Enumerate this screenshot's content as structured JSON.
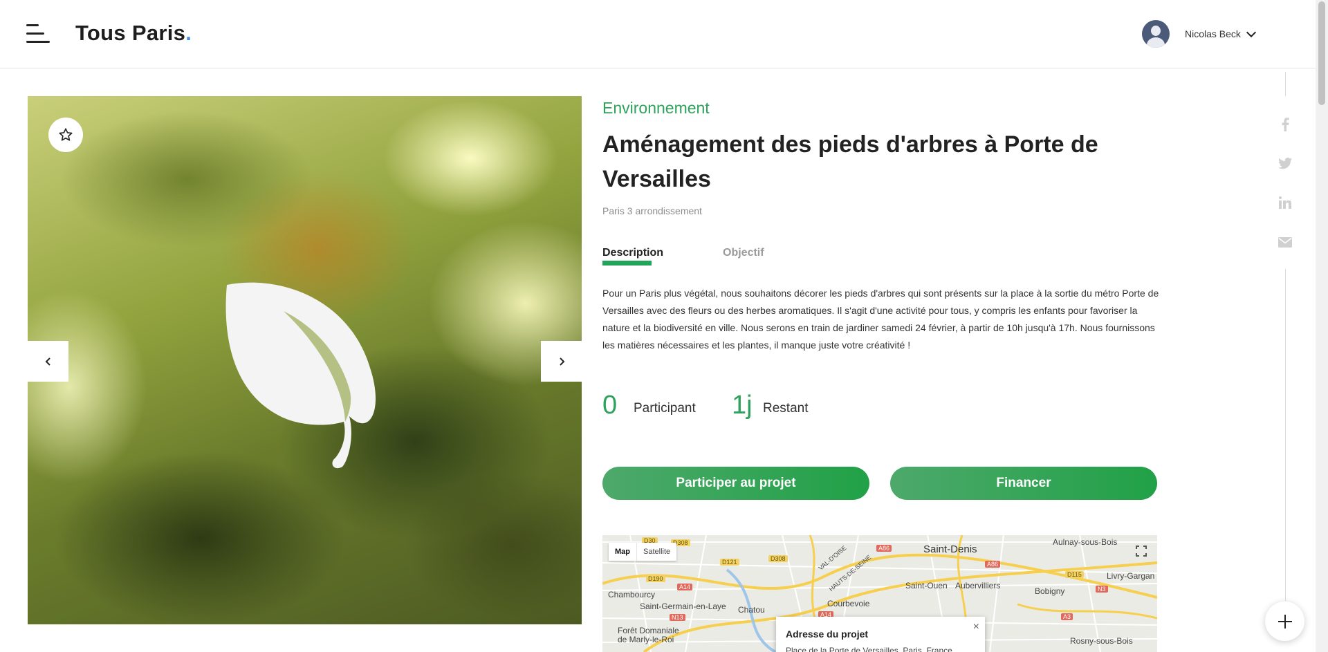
{
  "header": {
    "logo_text": "Tous Paris",
    "logo_dot": ".",
    "user_name": "Nicolas Beck",
    "menu_icon": "hamburger-menu-icon",
    "chevron_icon": "chevron-down-icon"
  },
  "carousel": {
    "image_icon": "leaf-icon",
    "favorite_icon": "star-outline-icon",
    "prev_icon": "chevron-left-icon",
    "next_icon": "chevron-right-icon"
  },
  "project": {
    "category": "Environnement",
    "title": "Aménagement des pieds d'arbres à Porte de Versailles",
    "location": "Paris 3 arrondissement",
    "tabs": [
      {
        "label": "Description",
        "active": true
      },
      {
        "label": "Objectif",
        "active": false
      }
    ],
    "description": "Pour un Paris plus végétal, nous souhaitons décorer les pieds d'arbres qui sont présents sur la place à la sortie du métro Porte de Versailles avec des fleurs ou des herbes aromatiques. Il s'agit d'une activité pour tous, y compris les enfants pour favoriser la nature et la biodiversité en ville. Nous serons en train de jardiner samedi 24 février, à partir de 10h jusqu'à 17h. Nous fournissons les matières nécessaires et les plantes, il manque juste votre créativité !",
    "stats": [
      {
        "value": "0",
        "label": "Participant"
      },
      {
        "value": "1j",
        "label": "Restant"
      }
    ],
    "participate_label": "Participer au projet",
    "finance_label": "Financer"
  },
  "map": {
    "type_map": "Map",
    "type_satellite": "Satellite",
    "fullscreen_icon": "fullscreen-icon",
    "places": [
      "Saint-Denis",
      "Aulnay-sous-Bois",
      "Livry-Gargan",
      "Bobigny",
      "Saint-Ouen",
      "Aubervilliers",
      "Chambourcy",
      "Saint-Germain-en-Laye",
      "Chatou",
      "Courbevoie",
      "Forêt Domaniale de Marly-le-Roi",
      "Rosny-sous-Bois",
      "VAL-D'OISE",
      "HAUTS-DE-SEINE"
    ],
    "roads": [
      "D30",
      "D308",
      "D121",
      "D308",
      "D190",
      "A14",
      "N13",
      "A86",
      "A86",
      "D115",
      "N3",
      "A3",
      "A14"
    ],
    "info_title": "Adresse du projet",
    "info_address": "Place de la Porte de Versailles, Paris, France",
    "info_close": "×"
  },
  "social": {
    "icons": [
      "facebook-icon",
      "twitter-icon",
      "linkedin-icon",
      "mail-icon"
    ],
    "add_icon": "plus-icon"
  },
  "colors": {
    "accent": "#2ea15c",
    "button_start": "#4da96b",
    "button_end": "#21a147",
    "logo_dot": "#3f8de0"
  }
}
